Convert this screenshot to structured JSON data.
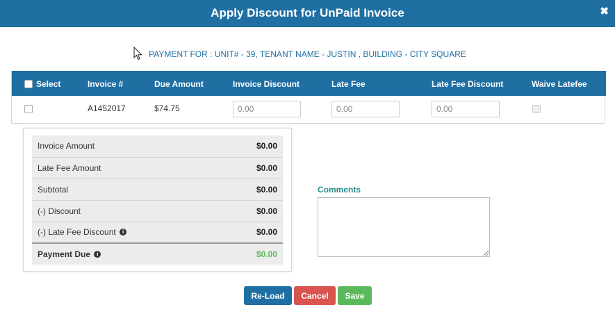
{
  "dialog": {
    "title": "Apply Discount for UnPaid Invoice",
    "close_symbol": "✖"
  },
  "payment_for": "PAYMENT FOR : UNIT# - 39, TENANT NAME - JUSTIN , BUILDING - CITY SQUARE",
  "grid": {
    "columns": {
      "select": "Select",
      "invoice_no": "Invoice #",
      "due_amount": "Due Amount",
      "invoice_discount": "Invoice Discount",
      "late_fee": "Late Fee",
      "late_fee_discount": "Late Fee Discount",
      "waive_latefee": "Waive Latefee"
    },
    "rows": [
      {
        "invoice_no": "A1452017",
        "due_amount": "$74.75",
        "invoice_discount_placeholder": "0.00",
        "late_fee_placeholder": "0.00",
        "late_fee_discount_placeholder": "0.00"
      }
    ]
  },
  "summary": {
    "invoice_amount": {
      "label": "Invoice Amount",
      "value": "$0.00"
    },
    "late_fee_amount": {
      "label": "Late Fee Amount",
      "value": "$0.00"
    },
    "subtotal": {
      "label": "Subtotal",
      "value": "$0.00"
    },
    "discount": {
      "label": "(-) Discount",
      "value": "$0.00"
    },
    "late_fee_discount": {
      "label": "(-) Late Fee Discount",
      "value": "$0.00"
    },
    "payment_due": {
      "label": "Payment Due",
      "value": "$0.00"
    }
  },
  "comments": {
    "label": "Comments",
    "value": ""
  },
  "buttons": {
    "reload": "Re-Load",
    "cancel": "Cancel",
    "save": "Save"
  },
  "colors": {
    "primary": "#1f6fa3",
    "danger": "#d9534f",
    "success": "#5cb85c",
    "comments_label": "#2a8a8a"
  }
}
